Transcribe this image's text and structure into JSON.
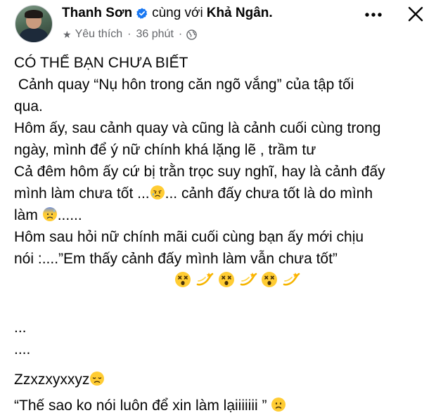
{
  "post": {
    "author": "Thanh Sơn",
    "with_text": "cùng với",
    "tagged": "Khả Ngân.",
    "audience": "Yêu thích",
    "separator": "·",
    "time": "36 phút",
    "separator2": "·"
  },
  "icons": {
    "verified": "verified-badge-icon",
    "more": "more-horizontal-icon",
    "close": "close-icon",
    "star": "star-icon",
    "globe": "globe-icon"
  },
  "body": {
    "l1": "CÓ THỂ BẠN CHƯA BIẾT",
    "l2": " Cảnh quay “Nụ hôn trong căn ngõ vắng” của tập tối",
    "l3": "qua.",
    "l4": "Hôm ấy, sau cảnh quay và cũng là cảnh cuối cùng trong",
    "l5": "ngày, mình để ý nữ chính khá lặng lẽ , trầm tư",
    "l6": "Cả đêm hôm ấy cứ bị trằn trọc suy nghĩ, hay là cảnh đấy",
    "l7a": "mình làm chưa tốt ...",
    "l7b": "... cảnh đấy chưa tốt là do mình",
    "l8a": "làm ",
    "l8b": "......",
    "l9": "Hôm sau hỏi nữ chính mãi cuối cùng bạn ấy mới chịu",
    "l10": "nói :....”Em thấy cảnh đấy mình làm vẫn chưa tốt”",
    "l11": "...",
    "l12": "....",
    "l13": "Zzxzxyxxyz",
    "l14": "“Thế sao ko nói luôn để xin làm lạiiiiiii ” "
  },
  "colors": {
    "text": "#050505",
    "meta": "#65676b",
    "verified": "#1877f2"
  }
}
